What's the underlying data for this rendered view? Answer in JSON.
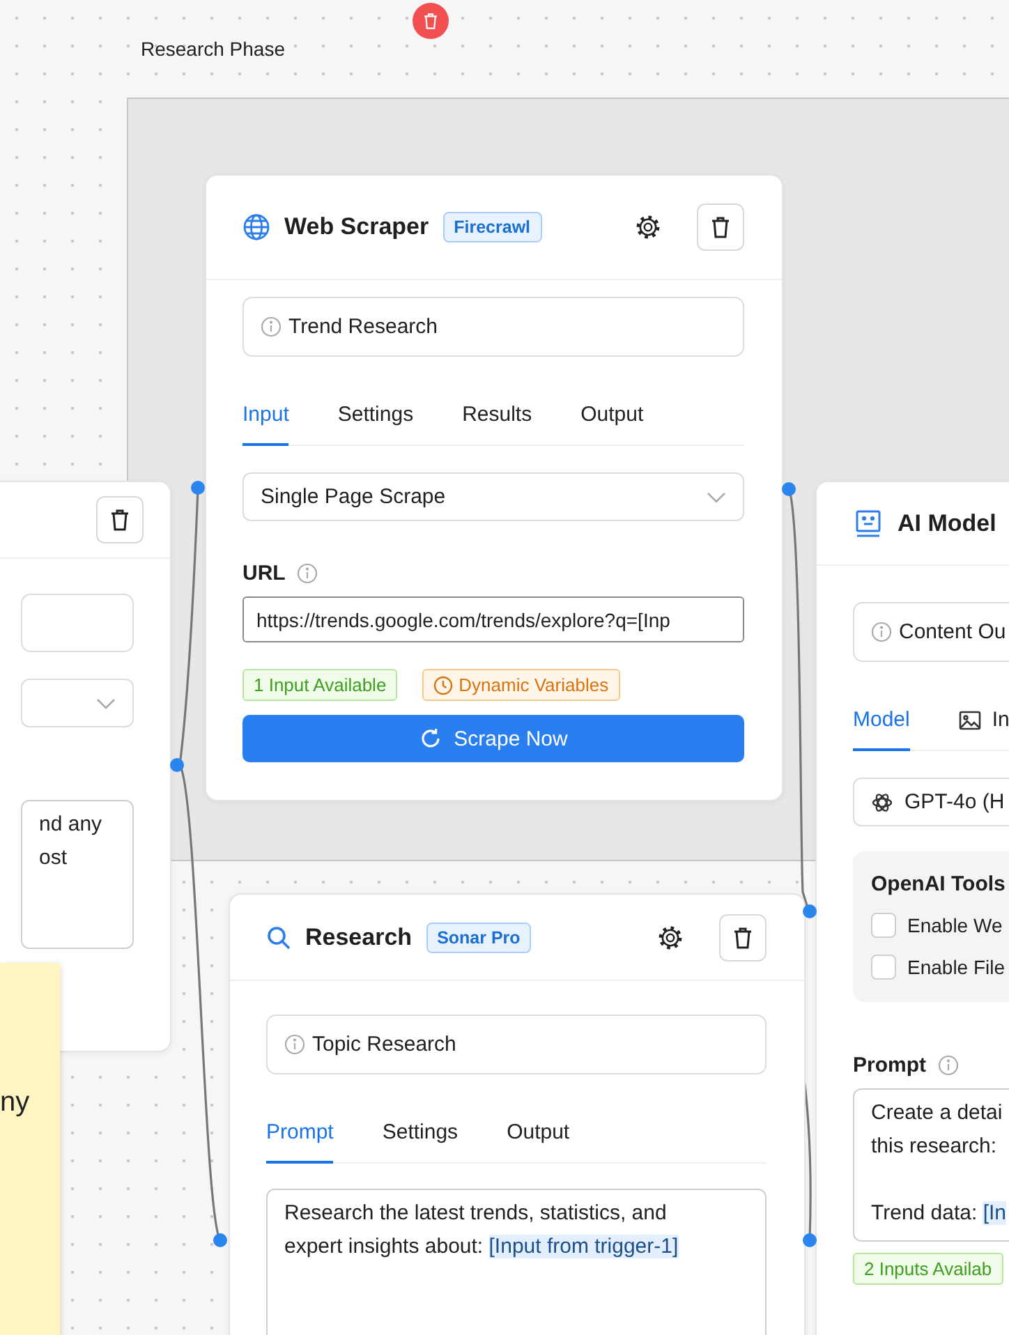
{
  "group": {
    "label": "Research Phase"
  },
  "nodes": [
    {
      "kind": "partial",
      "blocks": [
        {
          "kind": "name"
        },
        {
          "kind": "select"
        },
        {
          "kind": "prompt",
          "segments": [
            {
              "text": "nd any\nost",
              "variable": false
            }
          ]
        }
      ]
    },
    {
      "kind": "web-scraper",
      "title": "Web Scraper",
      "badge": "Firecrawl",
      "blocks": [
        {
          "kind": "name",
          "value": "Trend Research"
        },
        {
          "kind": "tabs",
          "tabs": [
            {
              "label": "Input",
              "selected": true
            },
            {
              "label": "Settings",
              "selected": false
            },
            {
              "label": "Results",
              "selected": false
            },
            {
              "label": "Output",
              "selected": false
            }
          ]
        },
        {
          "kind": "select",
          "value": "Single Page Scrape"
        },
        {
          "kind": "label",
          "text": "URL"
        },
        {
          "kind": "url",
          "value": "https://trends.google.com/trends/explore?q=[Inp"
        },
        {
          "kind": "chips",
          "chips": [
            {
              "kind": "inputs",
              "text": "1 Input Available"
            },
            {
              "kind": "variables",
              "text": "Dynamic Variables"
            }
          ]
        },
        {
          "kind": "button",
          "label": "Scrape Now"
        }
      ]
    },
    {
      "kind": "research",
      "title": "Research",
      "badge": "Sonar Pro",
      "blocks": [
        {
          "kind": "name",
          "value": "Topic Research"
        },
        {
          "kind": "tabs",
          "tabs": [
            {
              "label": "Prompt",
              "selected": true
            },
            {
              "label": "Settings",
              "selected": false
            },
            {
              "label": "Output",
              "selected": false
            }
          ]
        },
        {
          "kind": "prompt",
          "segments": [
            {
              "text": "Research the latest trends, statistics, and expert insights about: ",
              "variable": false
            },
            {
              "text": "[Input from trigger-1]",
              "variable": true
            }
          ]
        }
      ]
    },
    {
      "kind": "ai-model",
      "title": "AI Model",
      "blocks": [
        {
          "kind": "name",
          "value": "Content Ou"
        },
        {
          "kind": "tabs",
          "tabs": [
            {
              "label": "Model",
              "selected": true
            },
            {
              "label": "In",
              "selected": false
            }
          ]
        },
        {
          "kind": "model-select",
          "value": "GPT-4o (H"
        },
        {
          "kind": "tools",
          "title": "OpenAI Tools",
          "options": [
            {
              "label": "Enable We",
              "checked": false
            },
            {
              "label": "Enable File",
              "checked": false
            }
          ]
        },
        {
          "kind": "label",
          "text": "Prompt"
        },
        {
          "kind": "prompt",
          "segments": [
            {
              "text": "Create a detai\nthis research:\n\nTrend data: ",
              "variable": false
            },
            {
              "text": "[In",
              "variable": true
            }
          ]
        },
        {
          "kind": "chips",
          "chips": [
            {
              "kind": "inputs",
              "text": "2 Inputs Availab"
            }
          ]
        }
      ]
    }
  ],
  "sticky_note": {
    "text": "ny"
  }
}
